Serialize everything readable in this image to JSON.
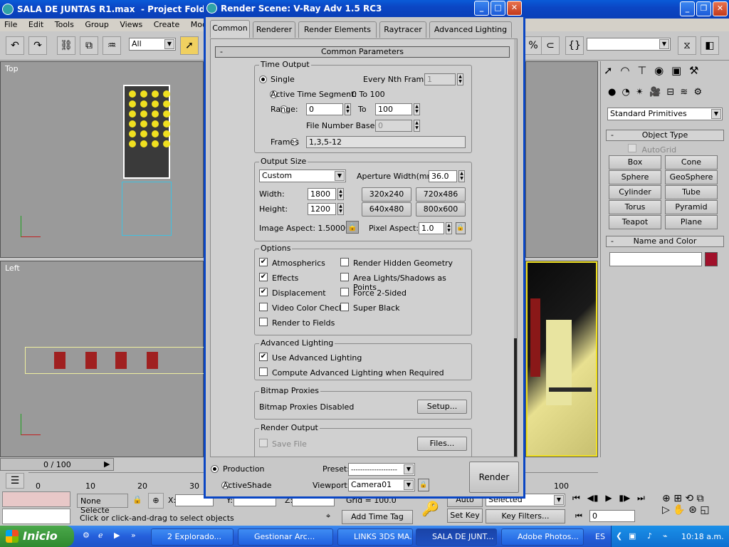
{
  "main_window": {
    "title": "SALA DE JUNTAS R1.max",
    "title_suffix": "- Project Fold"
  },
  "menu": [
    "File",
    "Edit",
    "Tools",
    "Group",
    "Views",
    "Create",
    "Modifiers"
  ],
  "toolbar": {
    "filter_value": "All"
  },
  "viewports": {
    "top_label": "Top",
    "left_label": "Left"
  },
  "timeline": {
    "frame": "0 / 100",
    "ticks": [
      "0",
      "10",
      "20",
      "30",
      "100"
    ]
  },
  "status": {
    "selection": "None Selecte",
    "x_label": "X:",
    "y_label": "Y:",
    "z_label": "Z:",
    "grid": "Grid = 100.0",
    "prompt": "Click or click-and-drag to select objects",
    "add_time_tag": "Add Time Tag",
    "auto_key": "Auto Key",
    "set_key": "Set Key",
    "selected": "Selected",
    "key_filters": "Key Filters...",
    "frame_field": "0"
  },
  "command_panel": {
    "category": "Standard Primitives",
    "object_type_title": "Object Type",
    "autogrid": "AutoGrid",
    "buttons": [
      "Box",
      "Cone",
      "Sphere",
      "GeoSphere",
      "Cylinder",
      "Tube",
      "Torus",
      "Pyramid",
      "Teapot",
      "Plane"
    ],
    "name_color_title": "Name and Color",
    "swatch_color": "#a0102a",
    "minus": "-"
  },
  "dialog": {
    "title": "Render Scene: V-Ray Adv 1.5 RC3",
    "tabs": [
      "Common",
      "Renderer",
      "Render Elements",
      "Raytracer",
      "Advanced Lighting"
    ],
    "rollout_title": "Common Parameters",
    "rollout_minus": "-",
    "time_output": {
      "title": "Time Output",
      "single": "Single",
      "every_nth_label": "Every Nth Frame:",
      "every_nth_value": "1",
      "active_segment": "Active Time Segment:",
      "active_segment_value": "0 To 100",
      "range": "Range:",
      "range_from": "0",
      "range_to_label": "To",
      "range_to": "100",
      "file_number_base_label": "File Number Base:",
      "file_number_base": "0",
      "frames": "Frames",
      "frames_value": "1,3,5-12"
    },
    "output_size": {
      "title": "Output Size",
      "preset": "Custom",
      "aperture_label": "Aperture Width(mm):",
      "aperture_value": "36.0",
      "width_label": "Width:",
      "width": "1800",
      "height_label": "Height:",
      "height": "1200",
      "presets": [
        "320x240",
        "720x486",
        "640x480",
        "800x600"
      ],
      "image_aspect": "Image Aspect: 1.50000",
      "pixel_aspect_label": "Pixel Aspect:",
      "pixel_aspect": "1.0"
    },
    "options": {
      "title": "Options",
      "left": [
        {
          "label": "Atmospherics",
          "checked": true
        },
        {
          "label": "Effects",
          "checked": true
        },
        {
          "label": "Displacement",
          "checked": true
        },
        {
          "label": "Video Color Check",
          "checked": false
        },
        {
          "label": "Render to Fields",
          "checked": false
        }
      ],
      "right": [
        {
          "label": "Render Hidden Geometry",
          "checked": false
        },
        {
          "label": "Area Lights/Shadows as Points",
          "checked": false
        },
        {
          "label": "Force 2-Sided",
          "checked": false
        },
        {
          "label": "Super Black",
          "checked": false
        }
      ]
    },
    "advanced_lighting": {
      "title": "Advanced Lighting",
      "use": "Use Advanced Lighting",
      "compute": "Compute Advanced Lighting when Required"
    },
    "bitmap_proxies": {
      "title": "Bitmap Proxies",
      "status": "Bitmap Proxies Disabled",
      "setup": "Setup..."
    },
    "render_output": {
      "title": "Render Output",
      "save_file": "Save File",
      "files": "Files..."
    },
    "bottom": {
      "production": "Production",
      "activeshade": "ActiveShade",
      "preset_label": "Preset:",
      "preset_value": "--------------------",
      "viewport_label": "Viewport:",
      "viewport_value": "Camera01",
      "render": "Render"
    },
    "check_mark": "✔"
  },
  "taskbar": {
    "start": "Inicio",
    "items": [
      "2 Explorado...",
      "Gestionar Arc...",
      "LINKS 3DS MA...",
      "SALA DE JUNT...",
      "Adobe Photos..."
    ],
    "lang": "ES",
    "time": "10:18 a.m."
  }
}
